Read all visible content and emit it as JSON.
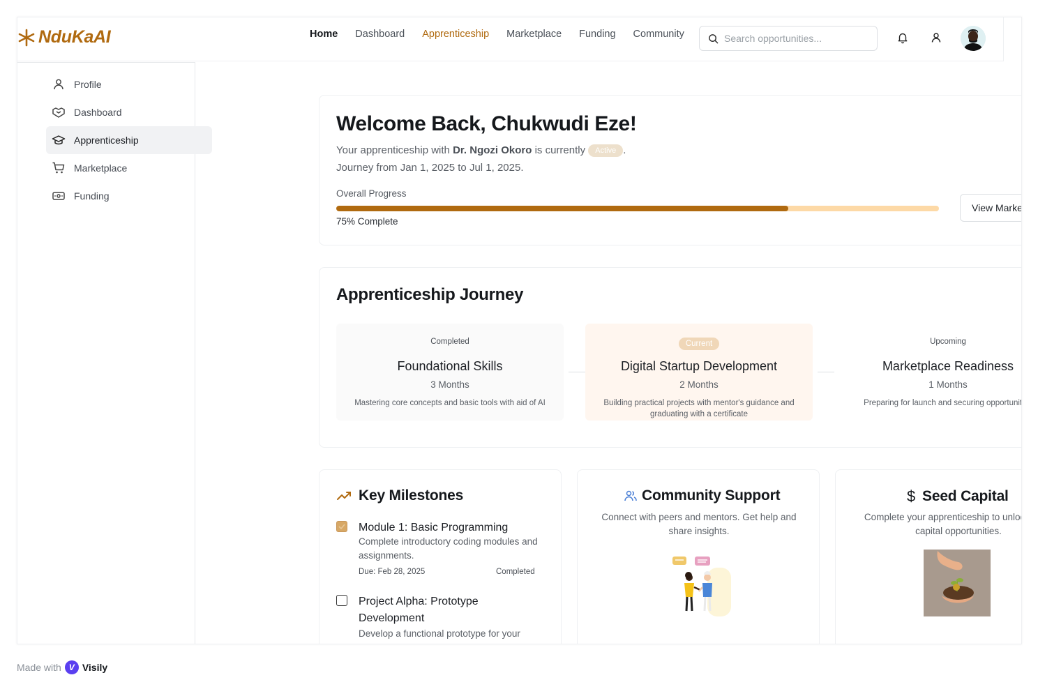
{
  "brand": {
    "name": "NduKaAI",
    "color": "#b06a10"
  },
  "nav": {
    "home": "Home",
    "dashboard": "Dashboard",
    "apprenticeship": "Apprenticeship",
    "marketplace": "Marketplace",
    "funding": "Funding",
    "community": "Community"
  },
  "search": {
    "placeholder": "Search opportunities..."
  },
  "icons": {
    "notifications": "bell-icon",
    "user": "user-icon",
    "search": "search-icon"
  },
  "sidebar": {
    "items": [
      {
        "label": "Profile",
        "icon": "user-icon"
      },
      {
        "label": "Dashboard",
        "icon": "handshake-icon"
      },
      {
        "label": "Apprenticeship",
        "icon": "graduation-cap-icon",
        "active": true
      },
      {
        "label": "Marketplace",
        "icon": "cart-icon"
      },
      {
        "label": "Funding",
        "icon": "money-icon"
      }
    ]
  },
  "welcome": {
    "title": "Welcome Back, Chukwudi Eze!",
    "line1_prefix": "Your apprenticeship with",
    "mentor": "Dr. Ngozi Okoro",
    "line1_mid": "is currently",
    "status": "Active",
    "line1_suffix": ".",
    "journey": "Journey from Jan 1, 2025 to Jul 1, 2025.",
    "progress_label": "Overall Progress",
    "progress_value": 75,
    "progress_text": "75% Complete",
    "button": "View Marketplace"
  },
  "journey": {
    "title": "Apprenticeship Journey",
    "stages": [
      {
        "status": "Completed",
        "name": "Foundational Skills",
        "duration": "3 Months",
        "desc": "Mastering core concepts and basic tools with aid of AI"
      },
      {
        "status": "Current",
        "name": "Digital Startup Development",
        "duration": "2 Months",
        "desc": "Building practical projects with mentor's guidance and graduating with a certificate"
      },
      {
        "status": "Upcoming",
        "name": "Marketplace Readiness",
        "duration": "1 Months",
        "desc": "Preparing for launch and securing opportunities"
      }
    ]
  },
  "milestones": {
    "title": "Key Milestones",
    "items": [
      {
        "title": "Module 1: Basic Programming",
        "desc": "Complete introductory coding modules and assignments.",
        "due": "Due: Feb 28, 2025",
        "state": "Completed",
        "done": true
      },
      {
        "title": "Project Alpha: Prototype Development",
        "desc": "Develop a functional prototype for your startup idea.",
        "done": false
      }
    ]
  },
  "community": {
    "title": "Community Support",
    "desc": "Connect with peers and mentors. Get help and share insights."
  },
  "seed": {
    "title": "Seed Capital",
    "desc": "Complete your apprenticeship to unlock seed capital opportunities."
  },
  "footer": {
    "made_with": "Made with",
    "brand": "Visily"
  },
  "colors": {
    "accent": "#b06a10",
    "progress_track": "#fdd9a6",
    "current_stage_bg": "#fff6ef",
    "completed_stage_bg": "#fafafa"
  }
}
